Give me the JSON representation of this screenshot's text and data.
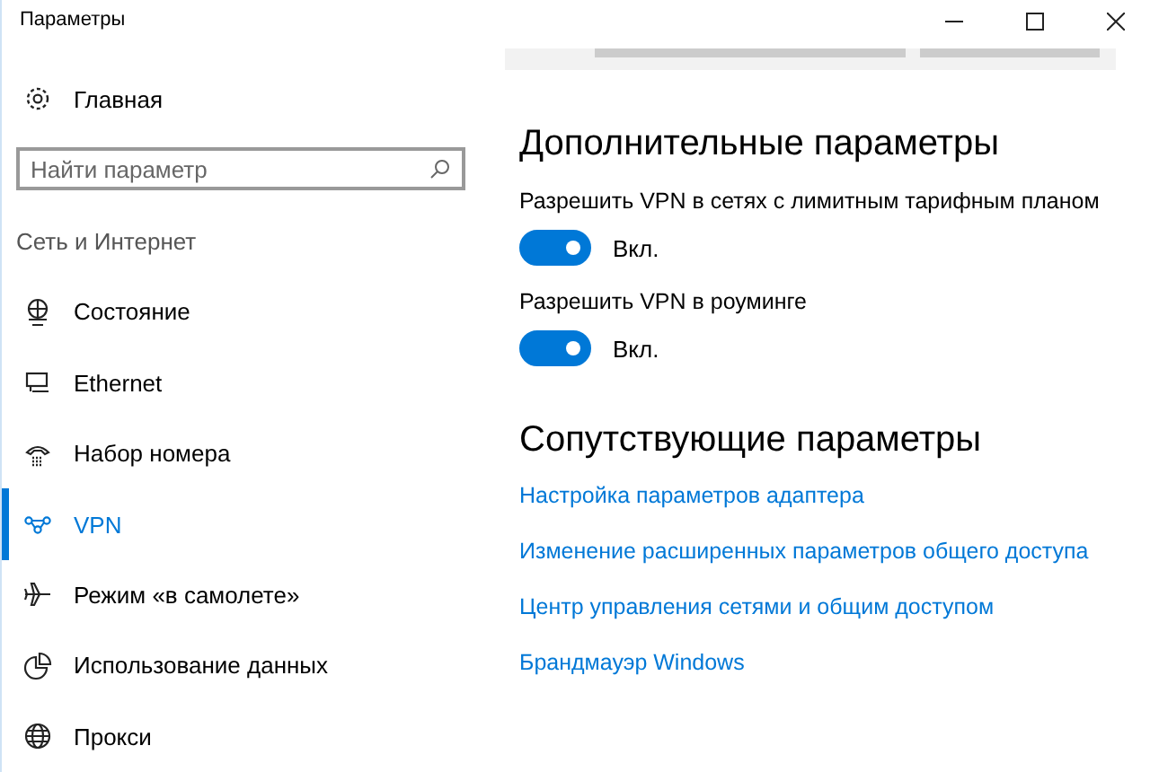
{
  "window": {
    "title": "Параметры"
  },
  "sidebar": {
    "home": "Главная",
    "search": {
      "placeholder": "Найти параметр"
    },
    "section": "Сеть и Интернет",
    "items": [
      {
        "label": "Состояние",
        "kind": "status",
        "selected": false
      },
      {
        "label": "Ethernet",
        "kind": "ethernet",
        "selected": false
      },
      {
        "label": "Набор номера",
        "kind": "dialup",
        "selected": false
      },
      {
        "label": "VPN",
        "kind": "vpn",
        "selected": true
      },
      {
        "label": "Режим «в самолете»",
        "kind": "airplane",
        "selected": false
      },
      {
        "label": "Использование данных",
        "kind": "data",
        "selected": false
      },
      {
        "label": "Прокси",
        "kind": "proxy",
        "selected": false
      }
    ]
  },
  "content": {
    "heading": "Дополнительные параметры",
    "settings": [
      {
        "label": "Разрешить VPN в сетях с лимитным тарифным планом",
        "on": true,
        "state": "Вкл."
      },
      {
        "label": "Разрешить VPN в роуминге",
        "on": true,
        "state": "Вкл."
      }
    ],
    "related_heading": "Сопутствующие параметры",
    "links": [
      "Настройка параметров адаптера",
      "Изменение расширенных параметров общего доступа",
      "Центр управления сетями и общим доступом",
      "Брандмауэр Windows"
    ]
  }
}
